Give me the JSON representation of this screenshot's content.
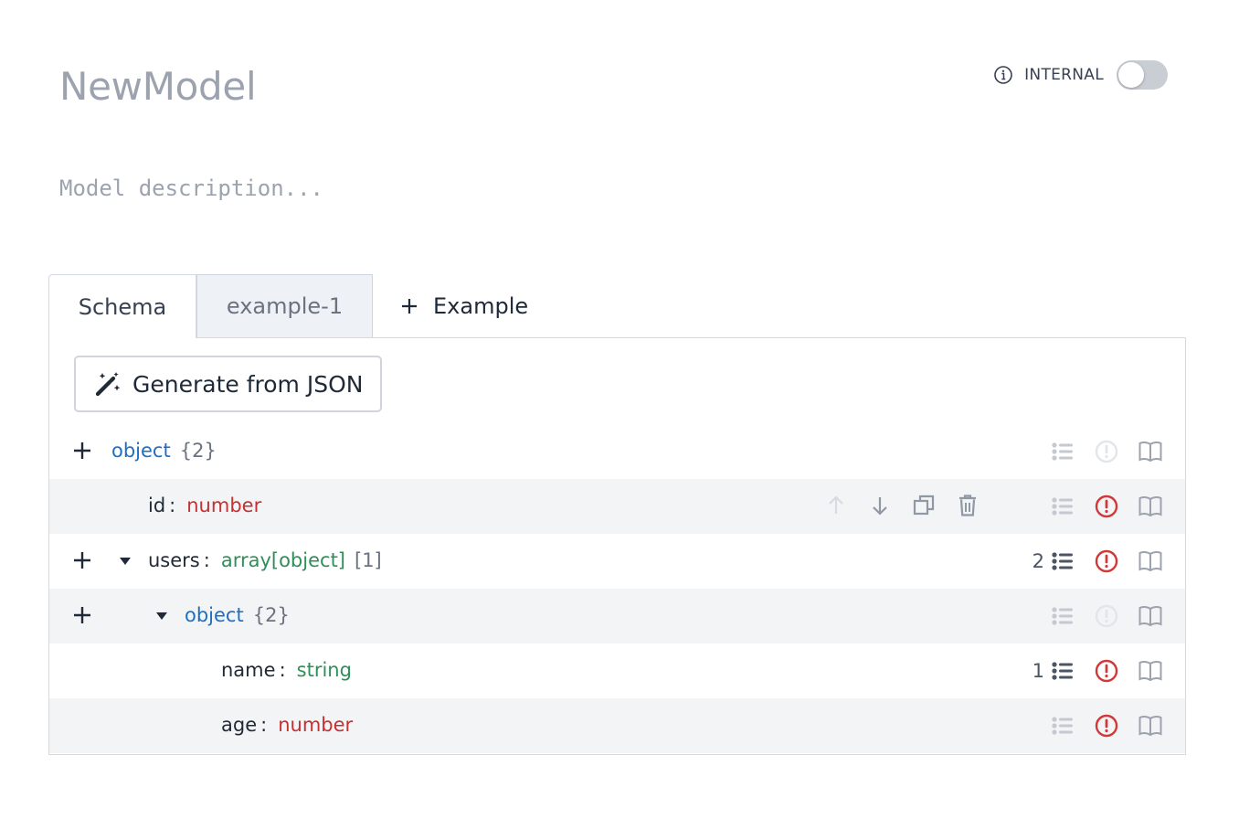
{
  "model": {
    "title": "NewModel",
    "description_placeholder": "Model description...",
    "description_value": ""
  },
  "internal": {
    "label": "INTERNAL",
    "toggle_on": false,
    "info_icon": "info-circle-icon"
  },
  "tabs": {
    "schema": "Schema",
    "example": "example-1",
    "add_label": "Example",
    "add_icon": "plus-icon"
  },
  "generate_button": {
    "label": "Generate from JSON",
    "icon": "magic-wand-icon"
  },
  "rows": [
    {
      "key": "",
      "type": "object",
      "meta": "{2}",
      "type_color": "blue",
      "validations_count": "",
      "error_active": false
    },
    {
      "key": "id",
      "type": "number",
      "meta": "",
      "type_color": "red",
      "validations_count": "",
      "error_active": true
    },
    {
      "key": "users",
      "type": "array[object]",
      "meta": "[1]",
      "type_color": "green",
      "validations_count": "2",
      "error_active": true
    },
    {
      "key": "",
      "type": "object",
      "meta": "{2}",
      "type_color": "blue",
      "validations_count": "",
      "error_active": false
    },
    {
      "key": "name",
      "type": "string",
      "meta": "",
      "type_color": "green",
      "validations_count": "1",
      "error_active": true
    },
    {
      "key": "age",
      "type": "number",
      "meta": "",
      "type_color": "red",
      "validations_count": "",
      "error_active": true
    }
  ],
  "row_actions": [
    "move-up-icon",
    "move-down-icon",
    "duplicate-icon",
    "delete-icon"
  ],
  "row_right_icons": [
    "validations-list-icon",
    "required-alert-icon",
    "description-book-icon"
  ],
  "colors": {
    "blue_type": "#1d6fc2",
    "green_type": "#2f8f58",
    "red_type": "#c53030",
    "alert_active": "#d23838",
    "icon_muted": "#9ca3af",
    "row_alt_bg": "#f3f4f6"
  }
}
